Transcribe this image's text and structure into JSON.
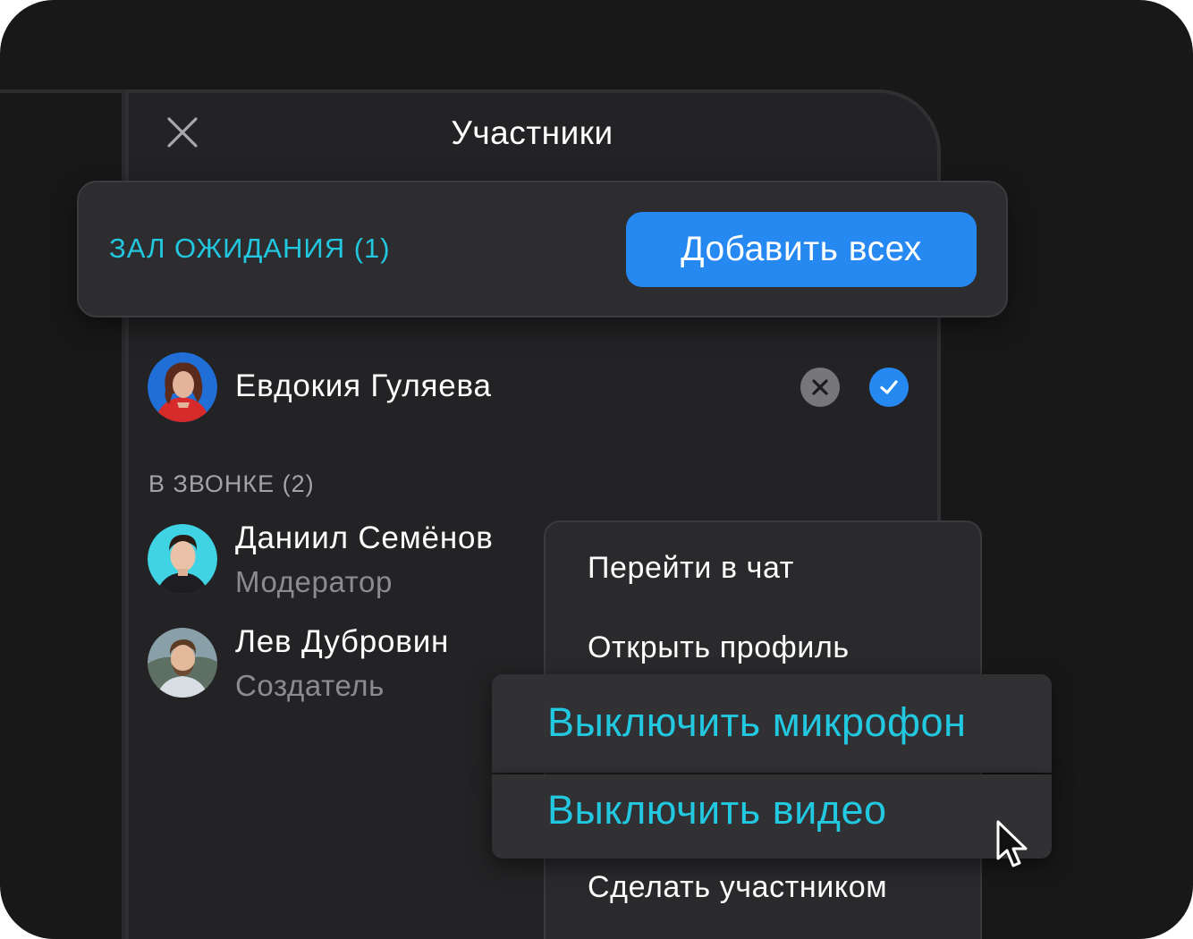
{
  "panel": {
    "title": "Участники",
    "close_icon": "close-icon"
  },
  "waiting_room": {
    "label": "ЗАЛ ОЖИДАНИЯ (1)",
    "add_all_label": "Добавить всех",
    "participants": [
      {
        "name": "Евдокия Гуляева",
        "decline_icon": "x-circle-icon",
        "accept_icon": "check-circle-icon"
      }
    ]
  },
  "in_call": {
    "label": "В ЗВОНКЕ (2)",
    "participants": [
      {
        "name": "Даниил Семёнов",
        "role": "Модератор"
      },
      {
        "name": "Лев Дубровин",
        "role": "Создатель"
      }
    ]
  },
  "context_menu": {
    "items": [
      "Перейти в чат",
      "Открыть профиль",
      "Выключить микрофон",
      "Выключить видео",
      "Сделать участником"
    ]
  },
  "colors": {
    "background": "#181818",
    "panel": "#232325",
    "accent": "#22c7e0",
    "primary_button": "#2688f1",
    "muted_text": "#8c8c90"
  }
}
